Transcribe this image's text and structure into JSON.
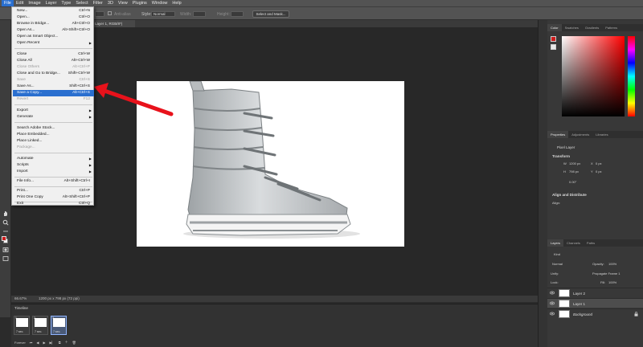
{
  "menubar": {
    "items": [
      "File",
      "Edit",
      "Image",
      "Layer",
      "Type",
      "Select",
      "Filter",
      "3D",
      "View",
      "Plugins",
      "Window",
      "Help"
    ]
  },
  "options": {
    "antialias": "Anti-alias",
    "style_label": "Style:",
    "style_value": "Normal",
    "width_label": "Width:",
    "height_label": "Height:",
    "select_mask": "Select and Mask..."
  },
  "document": {
    "tab_title": "Layer 1, RGB/8*)"
  },
  "file_menu": {
    "items": [
      {
        "label": "New...",
        "shortcut": "Ctrl+N"
      },
      {
        "label": "Open...",
        "shortcut": "Ctrl+O"
      },
      {
        "label": "Browse in Bridge...",
        "shortcut": "Alt+Ctrl+O"
      },
      {
        "label": "Open As...",
        "shortcut": "Alt+Shift+Ctrl+O"
      },
      {
        "label": "Open as Smart Object..."
      },
      {
        "label": "Open Recent",
        "submenu": true
      },
      {
        "label": "Close",
        "shortcut": "Ctrl+W"
      },
      {
        "label": "Close All",
        "shortcut": "Alt+Ctrl+W"
      },
      {
        "label": "Close Others",
        "shortcut": "Alt+Ctrl+P",
        "disabled": true
      },
      {
        "label": "Close and Go to Bridge...",
        "shortcut": "Shift+Ctrl+W"
      },
      {
        "label": "Save",
        "shortcut": "Ctrl+S",
        "disabled": true
      },
      {
        "label": "Save As...",
        "shortcut": "Shift+Ctrl+S"
      },
      {
        "label": "Save a Copy...",
        "shortcut": "Alt+Ctrl+S",
        "highlighted": true
      },
      {
        "label": "Revert",
        "shortcut": "F12",
        "disabled": true
      },
      {
        "label": "Export",
        "submenu": true
      },
      {
        "label": "Generate",
        "submenu": true
      },
      {
        "label": "Search Adobe Stock..."
      },
      {
        "label": "Place Embedded..."
      },
      {
        "label": "Place Linked..."
      },
      {
        "label": "Package...",
        "disabled": true
      },
      {
        "label": "Automate",
        "submenu": true
      },
      {
        "label": "Scripts",
        "submenu": true
      },
      {
        "label": "Import",
        "submenu": true
      },
      {
        "label": "File Info...",
        "shortcut": "Alt+Shift+Ctrl+I"
      },
      {
        "label": "Print...",
        "shortcut": "Ctrl+P"
      },
      {
        "label": "Print One Copy",
        "shortcut": "Alt+Shift+Ctrl+P"
      },
      {
        "label": "Exit",
        "shortcut": "Ctrl+Q"
      }
    ]
  },
  "statusbar": {
    "zoom": "66.67%",
    "doc_size": "1200 px x 798 px (72 ppi)"
  },
  "timeline": {
    "title": "Timeline",
    "frames": [
      {
        "num": "1",
        "delay": "7 sec."
      },
      {
        "num": "2",
        "delay": "7 sec."
      },
      {
        "num": "3",
        "delay": "7 sec."
      }
    ],
    "loop": "Forever"
  },
  "panels": {
    "color_tabs": [
      "Color",
      "Swatches",
      "Gradients",
      "Patterns"
    ],
    "properties_tabs": [
      "Properties",
      "Adjustments",
      "Libraries"
    ],
    "pixel_layer": "Pixel Layer",
    "transform": "Transform",
    "w_label": "W",
    "w_value": "1200 px",
    "h_label": "H",
    "h_value": "798 px",
    "x_label": "X",
    "x_value": "0 px",
    "y_label": "Y",
    "y_value": "0 px",
    "angle": "0.00°",
    "align": "Align and Distribute",
    "align_sub": "Align:",
    "layers_tabs": [
      "Layers",
      "Channels",
      "Paths"
    ],
    "kind": "Kind",
    "blend_mode": "Normal",
    "opacity_label": "Opacity:",
    "opacity_value": "100%",
    "unify": "Unify:",
    "propagate": "Propagate Frame 1",
    "lock": "Lock:",
    "fill_label": "Fill:",
    "fill_value": "100%",
    "layers": [
      "Layer 2",
      "Layer 1",
      "Background"
    ]
  },
  "colors": {
    "foreground": "#cc1b1b",
    "background": "#ffffff",
    "menu_highlight": "#2a6fcf",
    "annotation_arrow": "#e8121b"
  }
}
